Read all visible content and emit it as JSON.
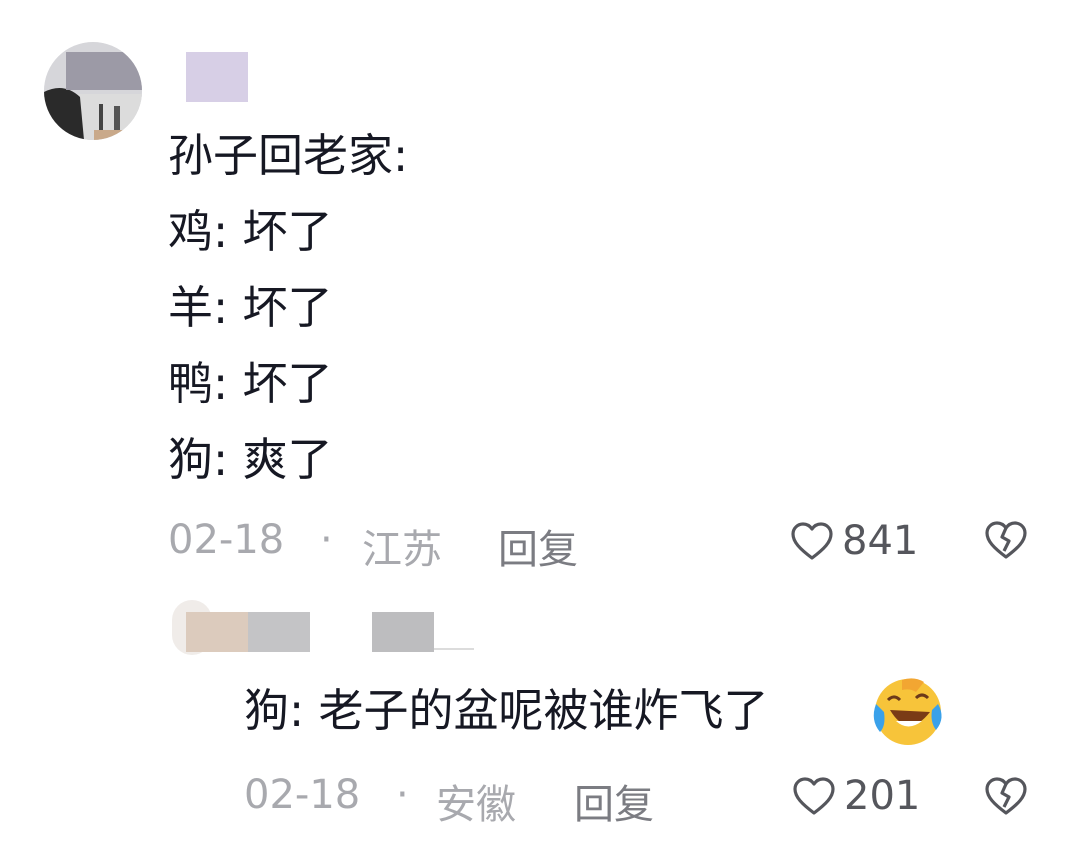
{
  "comment1": {
    "lines": [
      "孙子回老家:",
      "鸡: 坏了",
      "羊: 坏了",
      "鸭: 坏了",
      "狗: 爽了"
    ],
    "date": "02-18",
    "location": "江苏",
    "reply_label": "回复",
    "likes": "841"
  },
  "comment2": {
    "text": "狗: 老子的盆呢被谁炸飞了",
    "emoji": "laughing-with-tears-emoji",
    "date": "02-18",
    "location": "安徽",
    "reply_label": "回复",
    "likes": "201"
  },
  "colors": {
    "text": "#161823",
    "meta": "#a8a9ae",
    "action": "#7b7c82"
  }
}
